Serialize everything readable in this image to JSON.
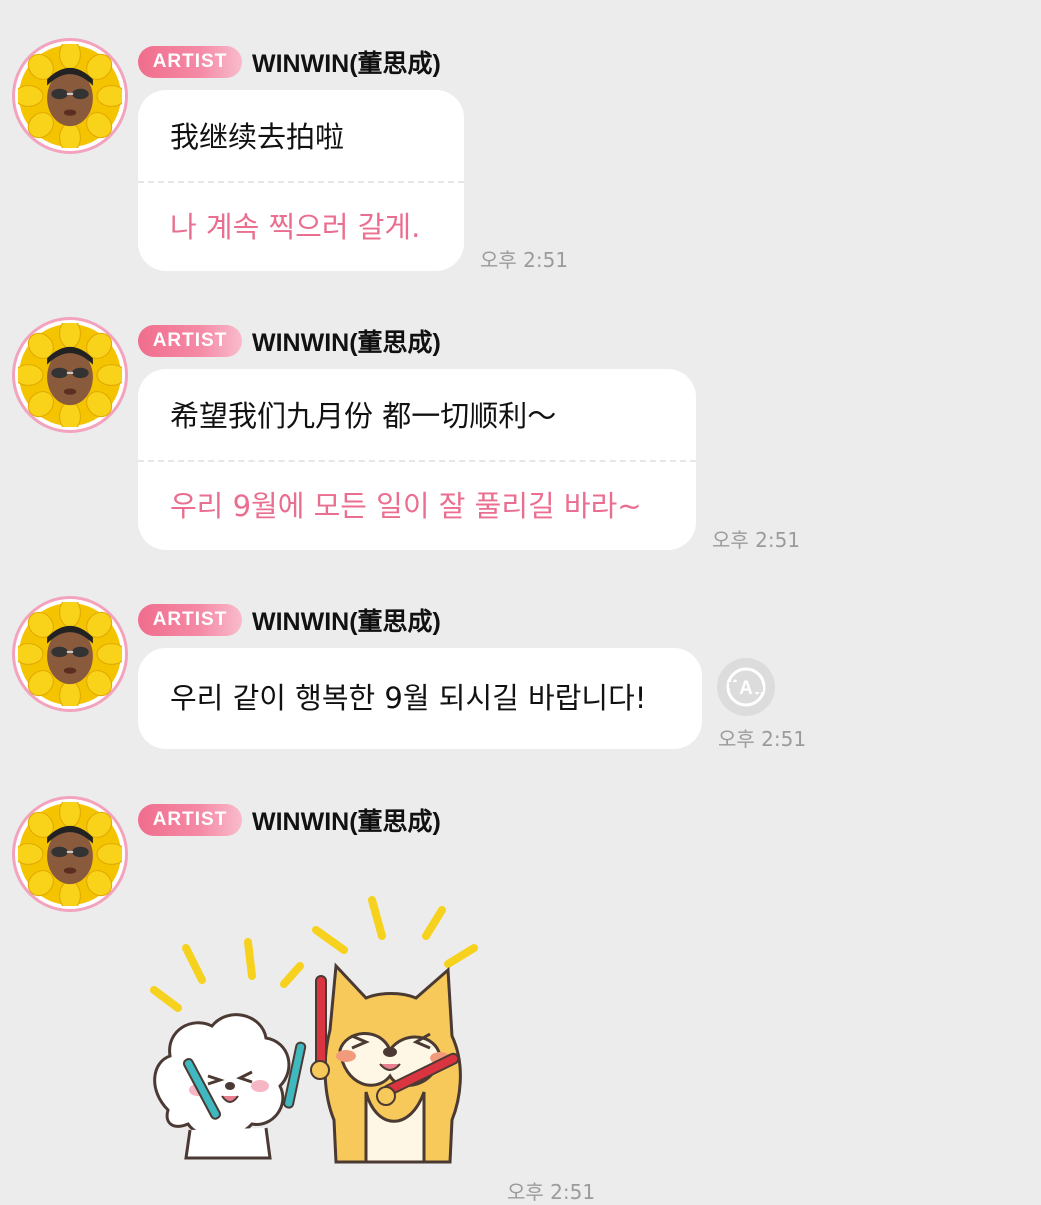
{
  "messages": [
    {
      "badge": "ARTIST",
      "name": "WINWIN(董思成)",
      "original": "我继续去拍啦",
      "translation": "나 계속 찍으러 갈게.",
      "time": "오후 2:51"
    },
    {
      "badge": "ARTIST",
      "name": "WINWIN(董思成)",
      "original": "希望我们九月份 都一切顺利〜",
      "translation": "우리 9월에 모든 일이 잘 풀리길 바라~",
      "time": "오후 2:51"
    },
    {
      "badge": "ARTIST",
      "name": "WINWIN(董思成)",
      "original": "우리 같이 행복한 9월 되시길 바랍니다!",
      "time": "오후 2:51",
      "translate_icon": "translate-icon"
    },
    {
      "badge": "ARTIST",
      "name": "WINWIN(董思成)",
      "sticker": "dog-and-shiba-cheering-sticker",
      "time": "오후 2:51"
    }
  ],
  "colors": {
    "background": "#ececec",
    "badge": "#f06d8d",
    "translation_text": "#ea6e8f",
    "avatar_ring": "#f3a3bd"
  }
}
